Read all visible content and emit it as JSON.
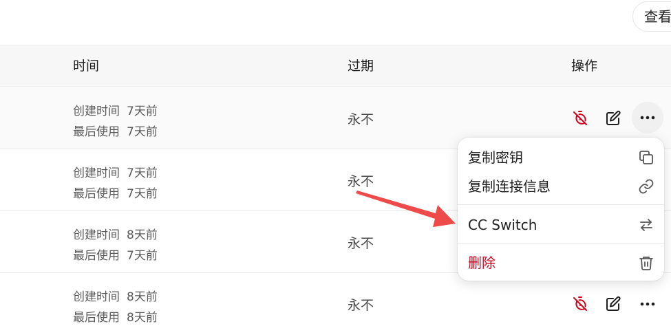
{
  "top": {
    "view_button": "查看"
  },
  "table": {
    "headers": {
      "time": "时间",
      "expire": "过期",
      "actions": "操作"
    },
    "rows": [
      {
        "created_label": "创建时间",
        "created": "7天前",
        "used_label": "最后使用",
        "used": "7天前",
        "expire": "永不"
      },
      {
        "created_label": "创建时间",
        "created": "7天前",
        "used_label": "最后使用",
        "used": "7天前",
        "expire": "永不"
      },
      {
        "created_label": "创建时间",
        "created": "8天前",
        "used_label": "最后使用",
        "used": "7天前",
        "expire": "永不"
      },
      {
        "created_label": "创建时间",
        "created": "8天前",
        "used_label": "最后使用",
        "used": "8天前",
        "expire": "永不"
      }
    ]
  },
  "menu": {
    "items": [
      {
        "label": "复制密钥",
        "icon": "copy-icon"
      },
      {
        "label": "复制连接信息",
        "icon": "link-icon"
      },
      {
        "label": "CC Switch",
        "icon": "switch-icon"
      },
      {
        "label": "删除",
        "icon": "trash-icon"
      }
    ]
  },
  "colors": {
    "danger": "#d0021b",
    "annotation_arrow": "#ef4a4a",
    "header_bg": "#f7f7f7"
  }
}
